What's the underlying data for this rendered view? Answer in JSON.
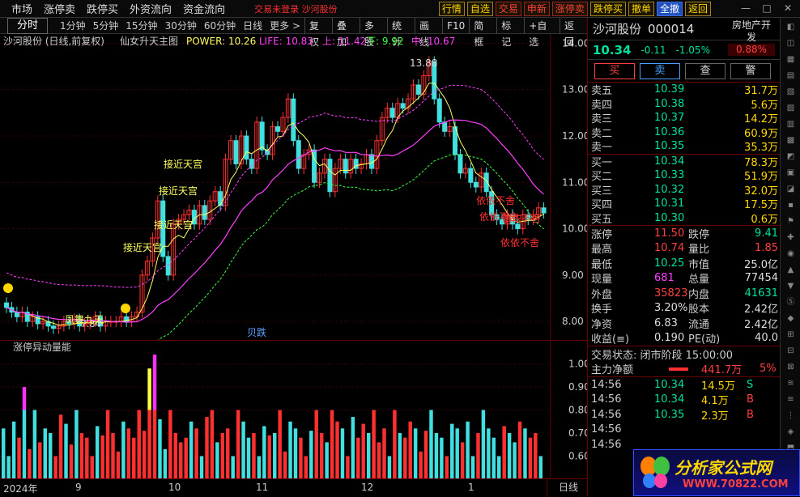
{
  "menu": [
    "市场",
    "涨停卖",
    "跌停买",
    "外资流向",
    "资金流向"
  ],
  "notice": "交易未登录  沙河股份",
  "top_buttons": [
    {
      "label": "行情",
      "s": "y"
    },
    {
      "label": "自选",
      "s": "y"
    },
    {
      "label": "交易",
      "s": "r"
    },
    {
      "label": "申新",
      "s": "r"
    },
    {
      "label": "涨停卖",
      "s": "r"
    },
    {
      "label": "跌停买",
      "s": "y"
    },
    {
      "label": "撤单",
      "s": "y"
    },
    {
      "label": "全撤",
      "s": "b"
    },
    {
      "label": "返回",
      "s": "y"
    }
  ],
  "periods": [
    "分时",
    "1分钟",
    "5分钟",
    "15分钟",
    "30分钟",
    "60分钟",
    "日线",
    "更多 >"
  ],
  "tools": [
    "复权",
    "叠加",
    "多股",
    "统计",
    "画线",
    "F10",
    "简框",
    "标记",
    "+自选",
    "返回"
  ],
  "indicator_line": {
    "title": "沙河股份 (日线,前复权)",
    "formula": "仙女升天主图",
    "power": "POWER: 10.26",
    "life": "LIFE: 10.83",
    "up": "上: 11.42",
    "down": "下: 9.92",
    "mid": "中: 10.67"
  },
  "price_axis": [
    "14.00",
    "13.00",
    "12.00",
    "11.00",
    "10.00",
    "9.00",
    "8.00"
  ],
  "ind_axis": [
    "1.00",
    "0.90",
    "0.80",
    "0.70",
    "0.60"
  ],
  "peak_label": "13.88",
  "low_label": "7.84",
  "annotations": [
    "接近天宫",
    "接近天宫",
    "接近天宫",
    "接近天宫",
    "依依不舍",
    "依依不舍",
    "依依不舍",
    "依依不舍",
    "凤舞九天"
  ],
  "signal": "贝跌",
  "sub_title": "涨停异动量能",
  "x_labels": [
    "2024年",
    "9",
    "10",
    "11",
    "12",
    "1"
  ],
  "x_period": "日线",
  "stock": {
    "name": "沙河股份",
    "code": "000014",
    "sector": "房地产开发",
    "sector_pct": "0.88%",
    "price": "10.34",
    "change": "-0.11",
    "pct": "-1.05%"
  },
  "actions": [
    "买",
    "卖",
    "查",
    "警"
  ],
  "asks": [
    {
      "l": "卖五",
      "v": "10.39",
      "q": "31.7万"
    },
    {
      "l": "卖四",
      "v": "10.38",
      "q": "5.6万"
    },
    {
      "l": "卖三",
      "v": "10.37",
      "q": "14.2万"
    },
    {
      "l": "卖二",
      "v": "10.36",
      "q": "60.9万"
    },
    {
      "l": "卖一",
      "v": "10.35",
      "q": "35.3万"
    }
  ],
  "bids": [
    {
      "l": "买一",
      "v": "10.34",
      "q": "78.3万"
    },
    {
      "l": "买二",
      "v": "10.33",
      "q": "51.9万"
    },
    {
      "l": "买三",
      "v": "10.32",
      "q": "32.0万"
    },
    {
      "l": "买四",
      "v": "10.31",
      "q": "17.5万"
    },
    {
      "l": "买五",
      "v": "10.30",
      "q": "0.6万"
    }
  ],
  "stats": [
    {
      "a": "涨停",
      "av": "11.50",
      "ac": "red",
      "b": "跌停",
      "bv": "9.41",
      "bc": "grn"
    },
    {
      "a": "最高",
      "av": "10.74",
      "ac": "red",
      "b": "量比",
      "bv": "1.85",
      "bc": "red"
    },
    {
      "a": "最低",
      "av": "10.25",
      "ac": "grn",
      "b": "市值",
      "bv": "25.0亿",
      "bc": "wht"
    },
    {
      "a": "现量",
      "av": "681",
      "ac": "mag",
      "b": "总量",
      "bv": "77454",
      "bc": "wht"
    },
    {
      "a": "外盘",
      "av": "35823",
      "ac": "red",
      "b": "内盘",
      "bv": "41631",
      "bc": "grn"
    },
    {
      "a": "换手",
      "av": "3.20%",
      "ac": "wht",
      "b": "股本",
      "bv": "2.42亿",
      "bc": "wht"
    },
    {
      "a": "净资",
      "av": "6.83",
      "ac": "wht",
      "b": "流通",
      "bv": "2.42亿",
      "bc": "wht"
    },
    {
      "a": "收益(≡)",
      "av": "0.190",
      "ac": "wht",
      "b": "PE(动)",
      "bv": "40.0",
      "bc": "wht"
    }
  ],
  "trade_status": "交易状态: 闭市阶段 15:00:00",
  "main_net": {
    "label": "主力净额",
    "value": "441.7万",
    "pct": "5%"
  },
  "ticks": [
    {
      "t": "14:56",
      "p": "10.34",
      "v": "14.5万",
      "s": "S"
    },
    {
      "t": "14:56",
      "p": "10.34",
      "v": "4.1万",
      "s": "B"
    },
    {
      "t": "14:56",
      "p": "10.35",
      "v": "2.3万",
      "s": "B"
    },
    {
      "t": "14:56",
      "p": "",
      "v": "",
      "s": ""
    },
    {
      "t": "14:56",
      "p": "",
      "v": "",
      "s": ""
    }
  ],
  "logo": {
    "title": "分析家公式网",
    "url": "WWW.70822.COM"
  },
  "chart_data": {
    "type": "candlestick",
    "ylim": [
      7.6,
      14.2
    ],
    "close": [
      8.3,
      8.2,
      8.1,
      8.2,
      8.0,
      8.1,
      7.95,
      8.0,
      7.9,
      7.85,
      7.9,
      8.0,
      7.95,
      8.05,
      7.9,
      7.95,
      8.0,
      8.1,
      7.9,
      8.0,
      8.0,
      8.0,
      8.1,
      8.0,
      8.1,
      8.2,
      9.0,
      9.3,
      9.8,
      10.6,
      9.4,
      9.0,
      10.1,
      10.2,
      10.3,
      10.4,
      10.1,
      10.5,
      10.2,
      10.6,
      10.8,
      10.5,
      11.5,
      11.9,
      11.4,
      12.0,
      11.5,
      11.3,
      12.3,
      11.7,
      11.6,
      12.2,
      12.1,
      12.4,
      12.8,
      11.9,
      11.3,
      11.6,
      11.7,
      11.0,
      11.2,
      11.5,
      10.8,
      11.3,
      11.5,
      11.2,
      11.5,
      11.3,
      11.4,
      11.6,
      11.3,
      11.9,
      12.4,
      12.6,
      12.4,
      12.7,
      12.6,
      12.8,
      13.1,
      12.9,
      13.3,
      13.6,
      12.8,
      12.3,
      12.1,
      12.2,
      11.6,
      11.2,
      11.3,
      11.0,
      10.9,
      11.2,
      10.8,
      10.3,
      10.2,
      10.1,
      10.3,
      10.1,
      10.0,
      10.3,
      10.2,
      10.3,
      10.45,
      10.34
    ],
    "ind_values": [
      0.72,
      0.6,
      0.75,
      0.68,
      0.9,
      0.63,
      0.8,
      0.66,
      0.72,
      0.7,
      0.6,
      0.78,
      0.74,
      0.65,
      0.8,
      0.7,
      0.68,
      0.6,
      0.73,
      0.69,
      0.8,
      0.7,
      0.62,
      0.75,
      0.72,
      0.68,
      0.8,
      0.71,
      0.98,
      1.04,
      0.76,
      0.63,
      0.8,
      0.7,
      0.66,
      0.68,
      0.75,
      0.72,
      0.6,
      0.77,
      0.8,
      0.66,
      0.7,
      0.72,
      0.6,
      0.8,
      0.75,
      0.68,
      0.7,
      0.6,
      0.73,
      0.69,
      0.7,
      0.8,
      0.62,
      0.75,
      0.72,
      0.68,
      0.6,
      0.71,
      0.8,
      0.7,
      0.66,
      0.8,
      0.75,
      0.72,
      0.6,
      0.77,
      0.68,
      0.74,
      0.7,
      0.8,
      0.66,
      0.72,
      0.6,
      0.8,
      0.7,
      0.68,
      0.75,
      0.72,
      0.62,
      0.71,
      0.8,
      0.7,
      0.68,
      0.6,
      0.74,
      0.72,
      0.66,
      0.75,
      0.6,
      0.7,
      0.8,
      0.72,
      0.68,
      0.6,
      0.73,
      0.7,
      0.66,
      0.75,
      0.72,
      0.68,
      0.7,
      0.6
    ]
  },
  "colors": {
    "up": "#ff3030",
    "down": "#40e0e0",
    "power": "#ffff60",
    "life": "#ff40ff",
    "band": "#ff40ff",
    "lower": "#40ff40",
    "ind_hi": "#ff30ff",
    "ind_y": "#ffff40"
  }
}
